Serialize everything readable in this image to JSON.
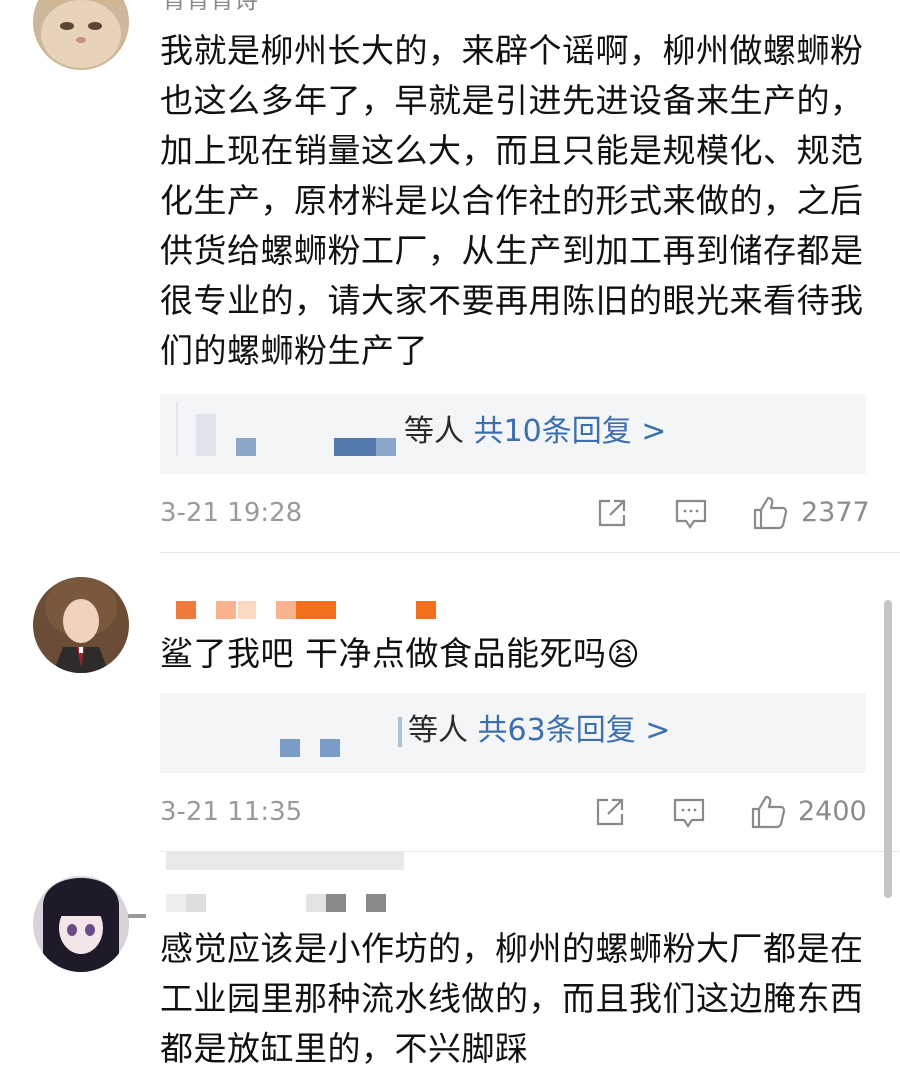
{
  "comments": [
    {
      "username": "青青青诗",
      "text": "我就是柳州长大的，来辟个谣啊，柳州做螺蛳粉也这么多年了，早就是引进先进设备来生产的，加上现在销量这么大，而且只能是规模化、规范化生产，原材料是以合作社的形式来做的，之后供货给螺蛳粉工厂，从生产到加工再到储存都是很专业的，请大家不要再用陈旧的眼光来看待我们的螺蛳粉生产了",
      "reply_suffix": "等人",
      "reply_count_label": "共10条回复 >",
      "time": "3-21 19:28",
      "likes": "2377"
    },
    {
      "text": "鲨了我吧 干净点做食品能死吗",
      "emoji": "😫",
      "reply_suffix": "等人",
      "reply_count_label": "共63条回复 >",
      "time": "3-21 11:35",
      "likes": "2400"
    },
    {
      "text": "感觉应该是小作坊的，柳州的螺蛳粉大厂都是在工业园里那种流水线做的，而且我们这边腌东西都是放缸里的，不兴脚踩"
    }
  ],
  "colors": {
    "link": "#3c6fae",
    "reply_bg": "#f4f5f7",
    "meta": "#9a9a9a"
  },
  "icons": [
    "share-icon",
    "comment-icon",
    "like-icon"
  ]
}
